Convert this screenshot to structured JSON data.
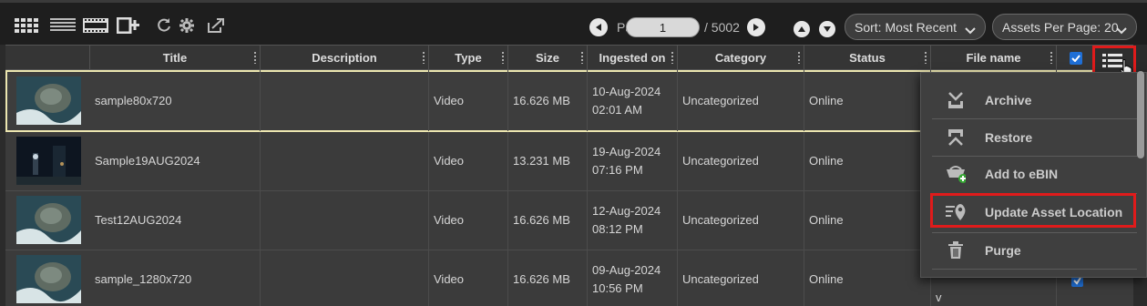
{
  "toolbar": {
    "view_icons": [
      "grid-view-icon",
      "list-view-icon",
      "filmstrip-view-icon",
      "add-asset-icon",
      "refresh-icon",
      "settings-icon",
      "export-icon"
    ],
    "page_label": "Page",
    "page_value": "1",
    "page_total": "/ 5002",
    "sort_label": "Sort: Most Recent",
    "per_page_label": "Assets Per Page: 20"
  },
  "table": {
    "columns": [
      "Title",
      "Description",
      "Type",
      "Size",
      "Ingested on",
      "Category",
      "Status",
      "File name"
    ],
    "rows": [
      {
        "title": "sample80x720",
        "description": "",
        "type": "Video",
        "size": "16.626 MB",
        "ingested_date": "10-Aug-2024",
        "ingested_time": "02:01 AM",
        "category": "Uncategorized",
        "status": "Online",
        "file_name": ""
      },
      {
        "title": "Sample19AUG2024",
        "description": "",
        "type": "Video",
        "size": "13.231 MB",
        "ingested_date": "19-Aug-2024",
        "ingested_time": "07:16 PM",
        "category": "Uncategorized",
        "status": "Online",
        "file_name": ""
      },
      {
        "title": "Test12AUG2024",
        "description": "",
        "type": "Video",
        "size": "16.626 MB",
        "ingested_date": "12-Aug-2024",
        "ingested_time": "08:12 PM",
        "category": "Uncategorized",
        "status": "Online",
        "file_name": ""
      },
      {
        "title": "sample_1280x720",
        "description": "",
        "type": "Video",
        "size": "16.626 MB",
        "ingested_date": "09-Aug-2024",
        "ingested_time": "10:56 PM",
        "category": "Uncategorized",
        "status": "Online",
        "file_name": "v"
      }
    ]
  },
  "menu": {
    "items": [
      {
        "label": "Archive",
        "icon": "archive-icon"
      },
      {
        "label": "Restore",
        "icon": "restore-icon"
      },
      {
        "label": "Add to eBIN",
        "icon": "add-to-ebin-icon"
      },
      {
        "label": "Update Asset Location",
        "icon": "location-pin-icon"
      },
      {
        "label": "Purge",
        "icon": "trash-icon"
      }
    ]
  },
  "colors": {
    "highlight": "#e01b1b",
    "checkbox": "#1f6fd6",
    "selected_outline": "#ece6b0"
  }
}
